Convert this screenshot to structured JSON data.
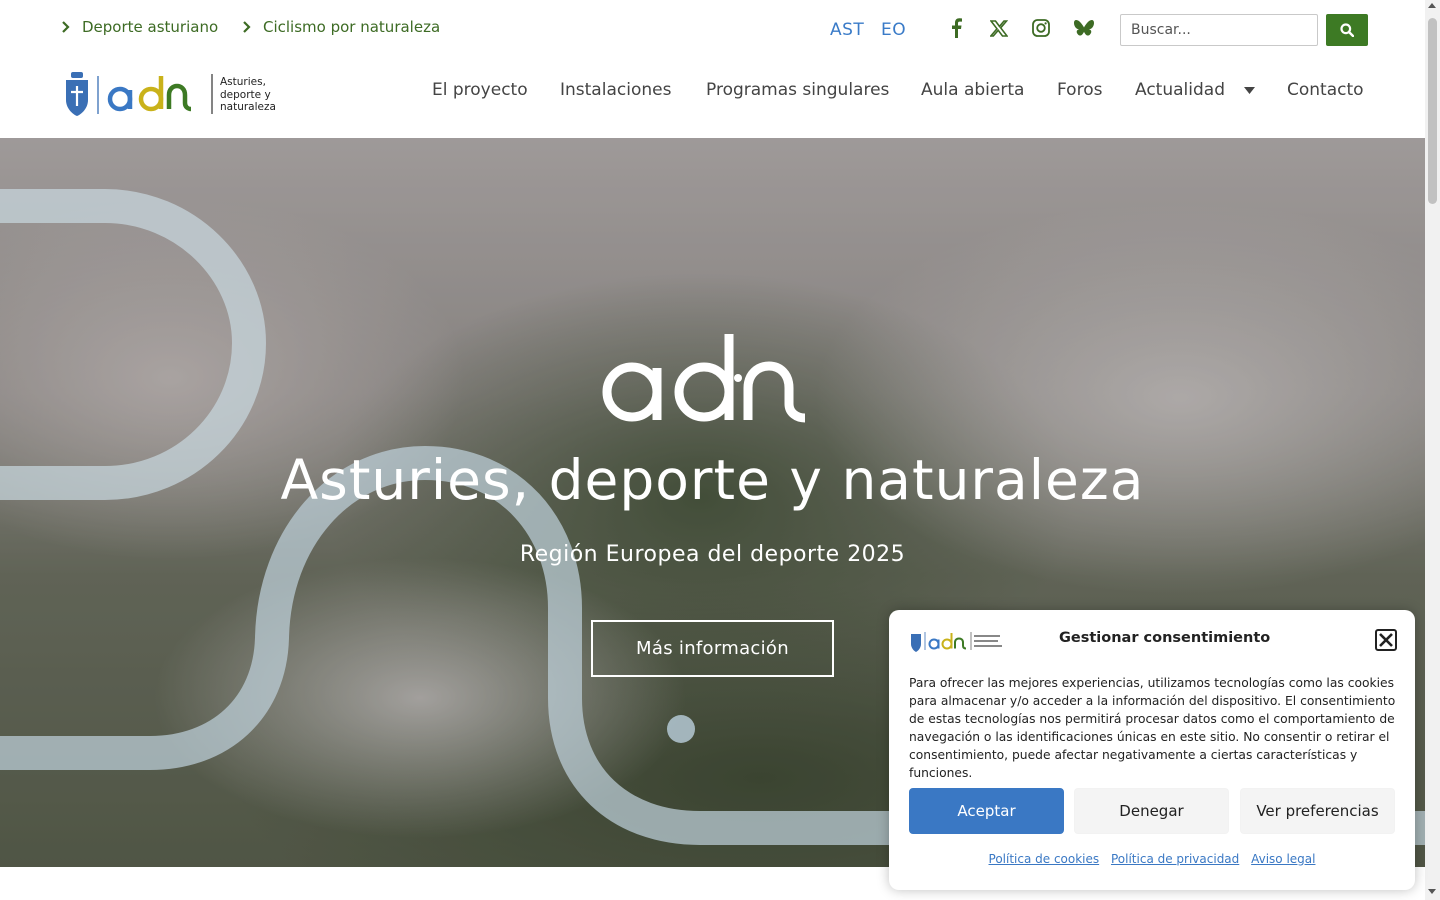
{
  "topbar": {
    "links": [
      {
        "label": "Deporte asturiano"
      },
      {
        "label": "Ciclismo por naturaleza"
      }
    ],
    "languages": [
      "AST",
      "EO"
    ],
    "social": [
      "facebook-icon",
      "x-icon",
      "instagram-icon",
      "bluesky-icon"
    ],
    "search": {
      "placeholder": "Buscar..."
    }
  },
  "brand": {
    "name": "adn",
    "tagline": [
      "Asturies,",
      "deporte y",
      "naturaleza"
    ],
    "colors": {
      "green": "#3d7a24",
      "blue": "#3a78c4",
      "yellow": "#c9b21a"
    }
  },
  "nav": {
    "items": [
      {
        "label": "El proyecto"
      },
      {
        "label": "Instalaciones"
      },
      {
        "label": "Programas singulares"
      },
      {
        "label": "Aula abierta"
      },
      {
        "label": "Foros"
      },
      {
        "label": "Actualidad"
      },
      {
        "label": "Contacto"
      }
    ]
  },
  "hero": {
    "logo_text": "adn",
    "title": "Asturies, deporte y naturaleza",
    "subtitle": "Región Europea del deporte 2025",
    "cta": "Más información"
  },
  "consent": {
    "title": "Gestionar consentimiento",
    "text": "Para ofrecer las mejores experiencias, utilizamos tecnologías como las cookies para almacenar y/o acceder a la información del dispositivo. El consentimiento de estas tecnologías nos permitirá procesar datos como el comportamiento de navegación o las identificaciones únicas en este sitio. No consentir o retirar el consentimiento, puede afectar negativamente a ciertas características y funciones.",
    "buttons": {
      "accept": "Aceptar",
      "deny": "Denegar",
      "prefs": "Ver preferencias"
    },
    "links": [
      "Política de cookies",
      "Política de privacidad",
      "Aviso legal"
    ]
  }
}
